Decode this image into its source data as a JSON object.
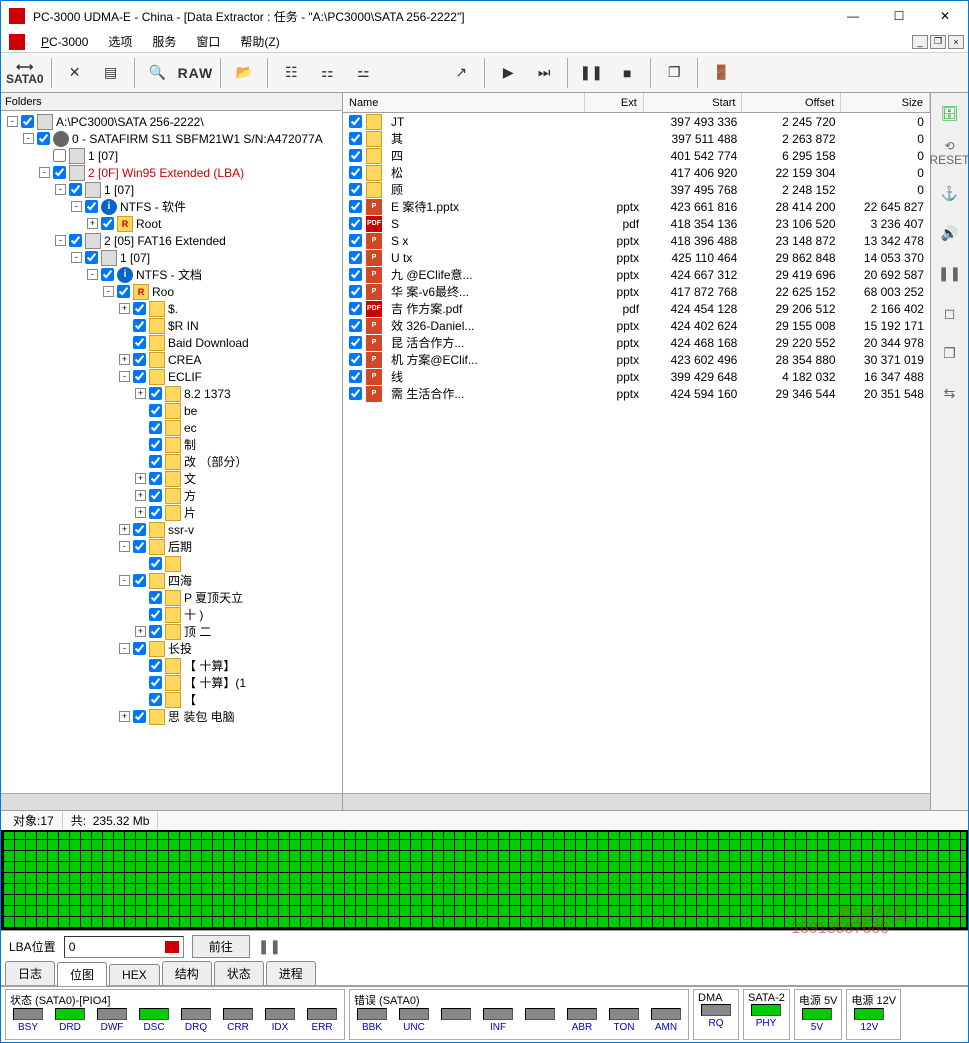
{
  "title": "PC-3000 UDMA-E - China - [Data Extractor : 任务 - \"A:\\PC3000\\SATA 256-2222\"]",
  "menu": {
    "app": "PC-3000",
    "items": [
      "选项",
      "服务",
      "窗口",
      "帮助(Z)"
    ]
  },
  "toolbar": {
    "sata": "SATA0",
    "raw": "RAW"
  },
  "folders_header": "Folders",
  "tree": [
    {
      "d": 0,
      "exp": "-",
      "ico": "drive",
      "label": "A:\\PC3000\\SATA 256-2222\\",
      "chk": true
    },
    {
      "d": 1,
      "exp": "-",
      "ico": "disk",
      "label": "0 - SATAFIRM   S11 SBFM21W1 S/N:A472077A",
      "chk": true
    },
    {
      "d": 2,
      "exp": " ",
      "ico": "drive",
      "label": "1 [07]",
      "chk": false
    },
    {
      "d": 2,
      "exp": "-",
      "ico": "drive",
      "label": "2 [0F] Win95 Extended  (LBA)",
      "chk": true,
      "red": true
    },
    {
      "d": 3,
      "exp": "-",
      "ico": "drive",
      "label": "1 [07]",
      "chk": true
    },
    {
      "d": 4,
      "exp": "-",
      "ico": "ntfs",
      "label": "NTFS - 软件",
      "chk": true
    },
    {
      "d": 5,
      "exp": "+",
      "ico": "root",
      "label": "Root",
      "chk": true
    },
    {
      "d": 3,
      "exp": "-",
      "ico": "drive",
      "label": "2 [05] FAT16 Extended",
      "chk": true
    },
    {
      "d": 4,
      "exp": "-",
      "ico": "drive",
      "label": "1 [07]",
      "chk": true
    },
    {
      "d": 5,
      "exp": "-",
      "ico": "ntfs",
      "label": "NTFS - 文档",
      "chk": true
    },
    {
      "d": 6,
      "exp": "-",
      "ico": "root",
      "label": "Roo",
      "chk": true,
      "blur": true
    },
    {
      "d": 7,
      "exp": "+",
      "ico": "folder",
      "label": "$.",
      "chk": true,
      "blur": true
    },
    {
      "d": 7,
      "exp": " ",
      "ico": "folder",
      "label": "$R          IN",
      "chk": true,
      "blur": true
    },
    {
      "d": 7,
      "exp": " ",
      "ico": "folder",
      "label": "Baid      Download",
      "chk": true,
      "blur": true
    },
    {
      "d": 7,
      "exp": "+",
      "ico": "folder",
      "label": "CREA",
      "chk": true,
      "blur": true
    },
    {
      "d": 7,
      "exp": "-",
      "ico": "folder",
      "label": "ECLIF",
      "chk": true,
      "blur": true
    },
    {
      "d": 8,
      "exp": "+",
      "ico": "folder",
      "label": "8.2       1373",
      "chk": true,
      "blur": true
    },
    {
      "d": 8,
      "exp": " ",
      "ico": "folder",
      "label": "be",
      "chk": true,
      "blur": true
    },
    {
      "d": 8,
      "exp": " ",
      "ico": "folder",
      "label": "ec",
      "chk": true,
      "blur": true
    },
    {
      "d": 8,
      "exp": " ",
      "ico": "folder",
      "label": "制",
      "chk": true,
      "blur": true
    },
    {
      "d": 8,
      "exp": " ",
      "ico": "folder",
      "label": "改          （部分）",
      "chk": true,
      "blur": true
    },
    {
      "d": 8,
      "exp": "+",
      "ico": "folder",
      "label": "文",
      "chk": true,
      "blur": true
    },
    {
      "d": 8,
      "exp": "+",
      "ico": "folder",
      "label": "方",
      "chk": true,
      "blur": true
    },
    {
      "d": 8,
      "exp": "+",
      "ico": "folder",
      "label": "           片",
      "chk": true,
      "blur": true
    },
    {
      "d": 7,
      "exp": "+",
      "ico": "folder",
      "label": "ssr-v",
      "chk": true,
      "blur": true
    },
    {
      "d": 7,
      "exp": "-",
      "ico": "folder",
      "label": "后期",
      "chk": true,
      "blur": true
    },
    {
      "d": 8,
      "exp": " ",
      "ico": "folder",
      "label": " ",
      "chk": true,
      "blur": true
    },
    {
      "d": 7,
      "exp": "-",
      "ico": "folder",
      "label": "四海",
      "chk": true,
      "blur": true
    },
    {
      "d": 8,
      "exp": " ",
      "ico": "folder",
      "label": "P          夏顶天立",
      "chk": true,
      "blur": true
    },
    {
      "d": 8,
      "exp": " ",
      "ico": "folder",
      "label": "十  )",
      "chk": true,
      "blur": true
    },
    {
      "d": 8,
      "exp": "+",
      "ico": "folder",
      "label": "顶        二",
      "chk": true,
      "blur": true
    },
    {
      "d": 7,
      "exp": "-",
      "ico": "folder",
      "label": "长投",
      "chk": true,
      "blur": true
    },
    {
      "d": 8,
      "exp": " ",
      "ico": "folder",
      "label": "【        十算】",
      "chk": true,
      "blur": true
    },
    {
      "d": 8,
      "exp": " ",
      "ico": "folder",
      "label": "【        十算】(1",
      "chk": true,
      "blur": true
    },
    {
      "d": 8,
      "exp": " ",
      "ico": "folder",
      "label": "【",
      "chk": true,
      "blur": true
    },
    {
      "d": 7,
      "exp": "+",
      "ico": "folder",
      "label": "思          装包 电脑",
      "chk": true,
      "blur": true
    }
  ],
  "list_cols": [
    "Name",
    "Ext",
    "Start",
    "Offset",
    "Size"
  ],
  "list": [
    {
      "ico": "folder",
      "name": "JT",
      "ext": "",
      "start": "397 493 336",
      "offset": "2 245 720",
      "size": "0",
      "blur": true
    },
    {
      "ico": "folder",
      "name": "其",
      "ext": "",
      "start": "397 511 488",
      "offset": "2 263 872",
      "size": "0",
      "blur": true
    },
    {
      "ico": "folder",
      "name": "四",
      "ext": "",
      "start": "401 542 774",
      "offset": "6 295 158",
      "size": "0",
      "blur": true
    },
    {
      "ico": "folder",
      "name": "松",
      "ext": "",
      "start": "417 406 920",
      "offset": "22 159 304",
      "size": "0",
      "blur": true
    },
    {
      "ico": "folder",
      "name": "顾",
      "ext": "",
      "start": "397 495 768",
      "offset": "2 248 152",
      "size": "0",
      "blur": true
    },
    {
      "ico": "ppt",
      "name": "E                     案待1.pptx",
      "ext": "pptx",
      "start": "423 661 816",
      "offset": "28 414 200",
      "size": "22 645 827",
      "blur": true
    },
    {
      "ico": "pdf",
      "name": "S",
      "ext": "pdf",
      "start": "418 354 136",
      "offset": "23 106 520",
      "size": "3 236 407",
      "blur": true
    },
    {
      "ico": "ppt",
      "name": "S                     x",
      "ext": "pptx",
      "start": "418 396 488",
      "offset": "23 148 872",
      "size": "13 342 478",
      "blur": true
    },
    {
      "ico": "ppt",
      "name": "U                     tx",
      "ext": "pptx",
      "start": "425 110 464",
      "offset": "29 862 848",
      "size": "14 053 370",
      "blur": true
    },
    {
      "ico": "ppt",
      "name": "九                    @EClife意...",
      "ext": "pptx",
      "start": "424 667 312",
      "offset": "29 419 696",
      "size": "20 692 587",
      "blur": true
    },
    {
      "ico": "ppt",
      "name": "华                    案-v6最终...",
      "ext": "pptx",
      "start": "417 872 768",
      "offset": "22 625 152",
      "size": "68 003 252",
      "blur": true
    },
    {
      "ico": "pdf",
      "name": "吉                    作方案.pdf",
      "ext": "pdf",
      "start": "424 454 128",
      "offset": "29 206 512",
      "size": "2 166 402",
      "blur": true
    },
    {
      "ico": "ppt",
      "name": "效                    326-Daniel...",
      "ext": "pptx",
      "start": "424 402 624",
      "offset": "29 155 008",
      "size": "15 192 171",
      "blur": true
    },
    {
      "ico": "ppt",
      "name": "昆                    活合作方...",
      "ext": "pptx",
      "start": "424 468 168",
      "offset": "29 220 552",
      "size": "20 344 978",
      "blur": true
    },
    {
      "ico": "ppt",
      "name": "机                    方案@EClif...",
      "ext": "pptx",
      "start": "423 602 496",
      "offset": "28 354 880",
      "size": "30 371 019",
      "blur": true
    },
    {
      "ico": "ppt",
      "name": "线",
      "ext": "pptx",
      "start": "399 429 648",
      "offset": "4 182 032",
      "size": "16 347 488",
      "blur": true
    },
    {
      "ico": "ppt",
      "name": "需                    生活合作...",
      "ext": "pptx",
      "start": "424 594 160",
      "offset": "29 346 544",
      "size": "20 351 548",
      "blur": true
    }
  ],
  "stats": {
    "objects_label": "对象:",
    "objects_val": "17",
    "total_label": "共:",
    "total_val": "235.32 Mb"
  },
  "lba": {
    "label": "LBA位置",
    "value": "0",
    "go": "前往"
  },
  "tabs": [
    "日志",
    "位图",
    "HEX",
    "结构",
    "状态",
    "进程"
  ],
  "tabs_active": 1,
  "status_groups": [
    {
      "title": "状态 (SATA0)-[PIO4]",
      "leds": [
        {
          "l": "BSY",
          "on": false
        },
        {
          "l": "DRD",
          "on": true
        },
        {
          "l": "DWF",
          "on": false
        },
        {
          "l": "DSC",
          "on": true
        },
        {
          "l": "DRQ",
          "on": false
        },
        {
          "l": "CRR",
          "on": false
        },
        {
          "l": "IDX",
          "on": false
        },
        {
          "l": "ERR",
          "on": false
        }
      ]
    },
    {
      "title": "错误 (SATA0)",
      "leds": [
        {
          "l": "BBK",
          "on": false
        },
        {
          "l": "UNC",
          "on": false
        },
        {
          "l": "",
          "on": false
        },
        {
          "l": "INF",
          "on": false
        },
        {
          "l": "",
          "on": false
        },
        {
          "l": "ABR",
          "on": false
        },
        {
          "l": "TON",
          "on": false
        },
        {
          "l": "AMN",
          "on": false
        }
      ]
    },
    {
      "title": "DMA",
      "leds": [
        {
          "l": "RQ",
          "on": false
        }
      ]
    },
    {
      "title": "SATA-2",
      "leds": [
        {
          "l": "PHY",
          "on": true
        }
      ]
    },
    {
      "title": "电源 5V",
      "leds": [
        {
          "l": "5V",
          "on": true
        }
      ]
    },
    {
      "title": "电源 12V",
      "leds": [
        {
          "l": "12V",
          "on": true
        }
      ]
    }
  ],
  "right_tools": [
    "db",
    "reset",
    "anchor",
    "sound",
    "pause",
    "stop",
    "copy",
    "link"
  ],
  "watermark": "数据恢复",
  "phone": "18913587680"
}
